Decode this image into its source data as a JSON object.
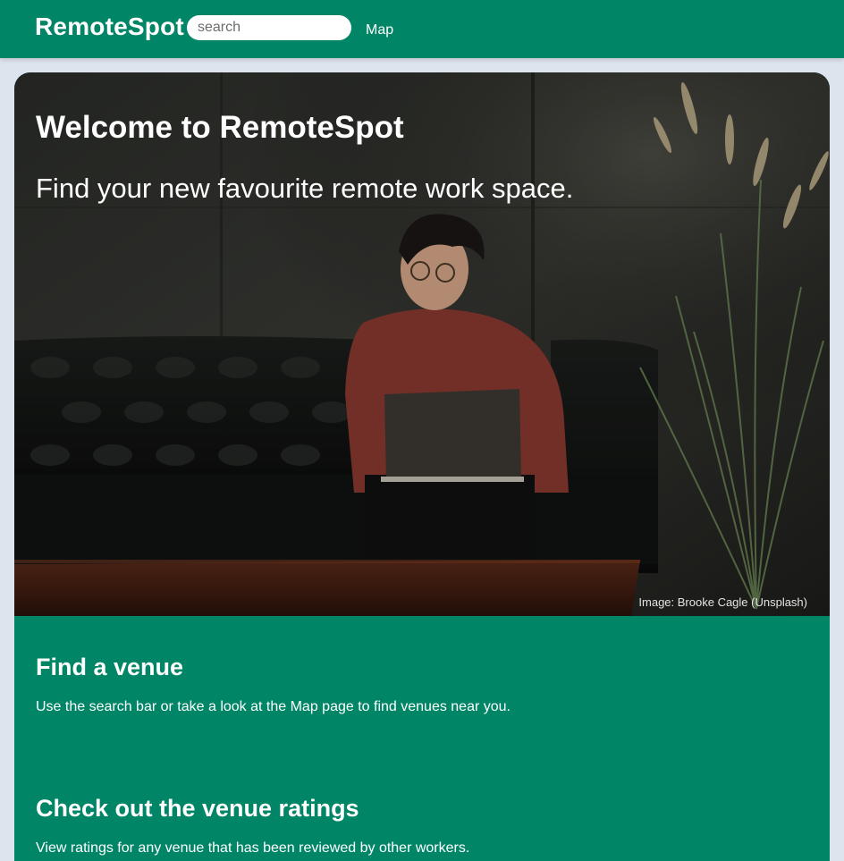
{
  "navbar": {
    "brand": "RemoteSpot",
    "search_placeholder": "search",
    "map_link": "Map",
    "color": "#008566"
  },
  "hero": {
    "title": "Welcome to RemoteSpot",
    "subtitle": "Find your new favourite remote work space.",
    "image_credit": "Image: Brooke Cagle (Unsplash)"
  },
  "sections": [
    {
      "heading": "Find a venue",
      "text": "Use the search bar or take a look at the Map page to find venues near you."
    },
    {
      "heading": "Check out the venue ratings",
      "text": "View ratings for any venue that has been reviewed by other workers."
    }
  ]
}
